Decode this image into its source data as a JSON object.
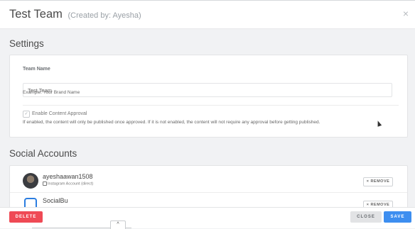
{
  "modal": {
    "title": "Test Team",
    "created_by": "(Created by: Ayesha)",
    "close_glyph": "×"
  },
  "settings": {
    "heading": "Settings",
    "team_name_label": "Team Name",
    "team_name_value": "Test Team",
    "team_name_hint": "Example: Your Brand Name",
    "approval_label": "Enable Content Approval",
    "approval_checked_glyph": "✓",
    "approval_help": "If enabled, the content will only be published once approved. If it is not enabled, the content will not require any approval before getting published."
  },
  "social": {
    "heading": "Social Accounts",
    "accounts": [
      {
        "name": "ayeshaawan1508",
        "type": "Instagram Account (direct)",
        "remove_label": "× REMOVE",
        "icon": "avatar"
      },
      {
        "name": "SocialBu",
        "type": "",
        "remove_label": "× REMOVE",
        "icon": "socialbu-logo-icon"
      }
    ]
  },
  "footer": {
    "delete_label": "DELETE",
    "close_label": "CLOSE",
    "save_label": "SAVE",
    "scroll_glyph": "^"
  },
  "colors": {
    "danger": "#ef4a55",
    "primary": "#3d8ef0",
    "neutral": "#e2e3e5"
  }
}
